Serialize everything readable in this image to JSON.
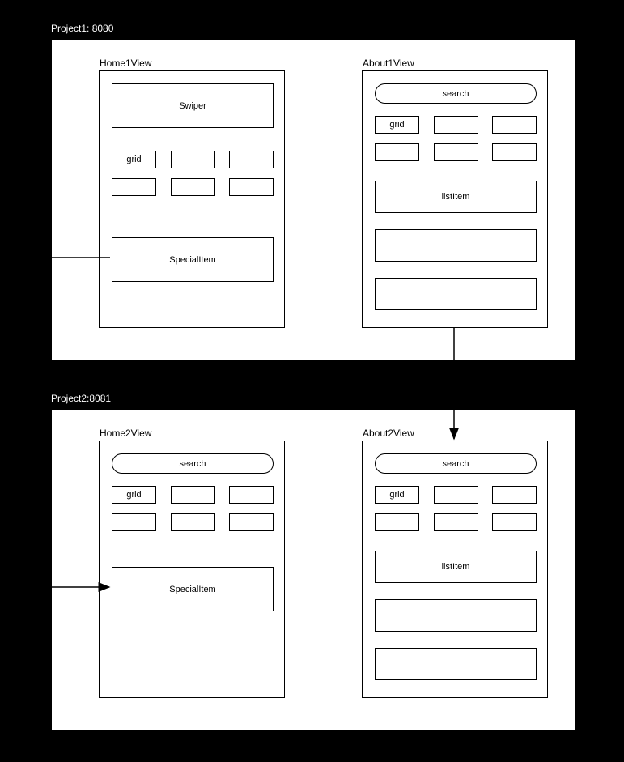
{
  "project1": {
    "label": "Project1: 8080",
    "home": {
      "title": "Home1View",
      "swiper": "Swiper",
      "gridLabel": "grid",
      "specialItem": "SpecialItem"
    },
    "about": {
      "title": "About1View",
      "search": "search",
      "gridLabel": "grid",
      "listItem": "listItem"
    }
  },
  "project2": {
    "label": "Project2:8081",
    "home": {
      "title": "Home2View",
      "search": "search",
      "gridLabel": "grid",
      "specialItem": "SpecialItem"
    },
    "about": {
      "title": "About2View",
      "search": "search",
      "gridLabel": "grid",
      "listItem": "listItem"
    }
  }
}
